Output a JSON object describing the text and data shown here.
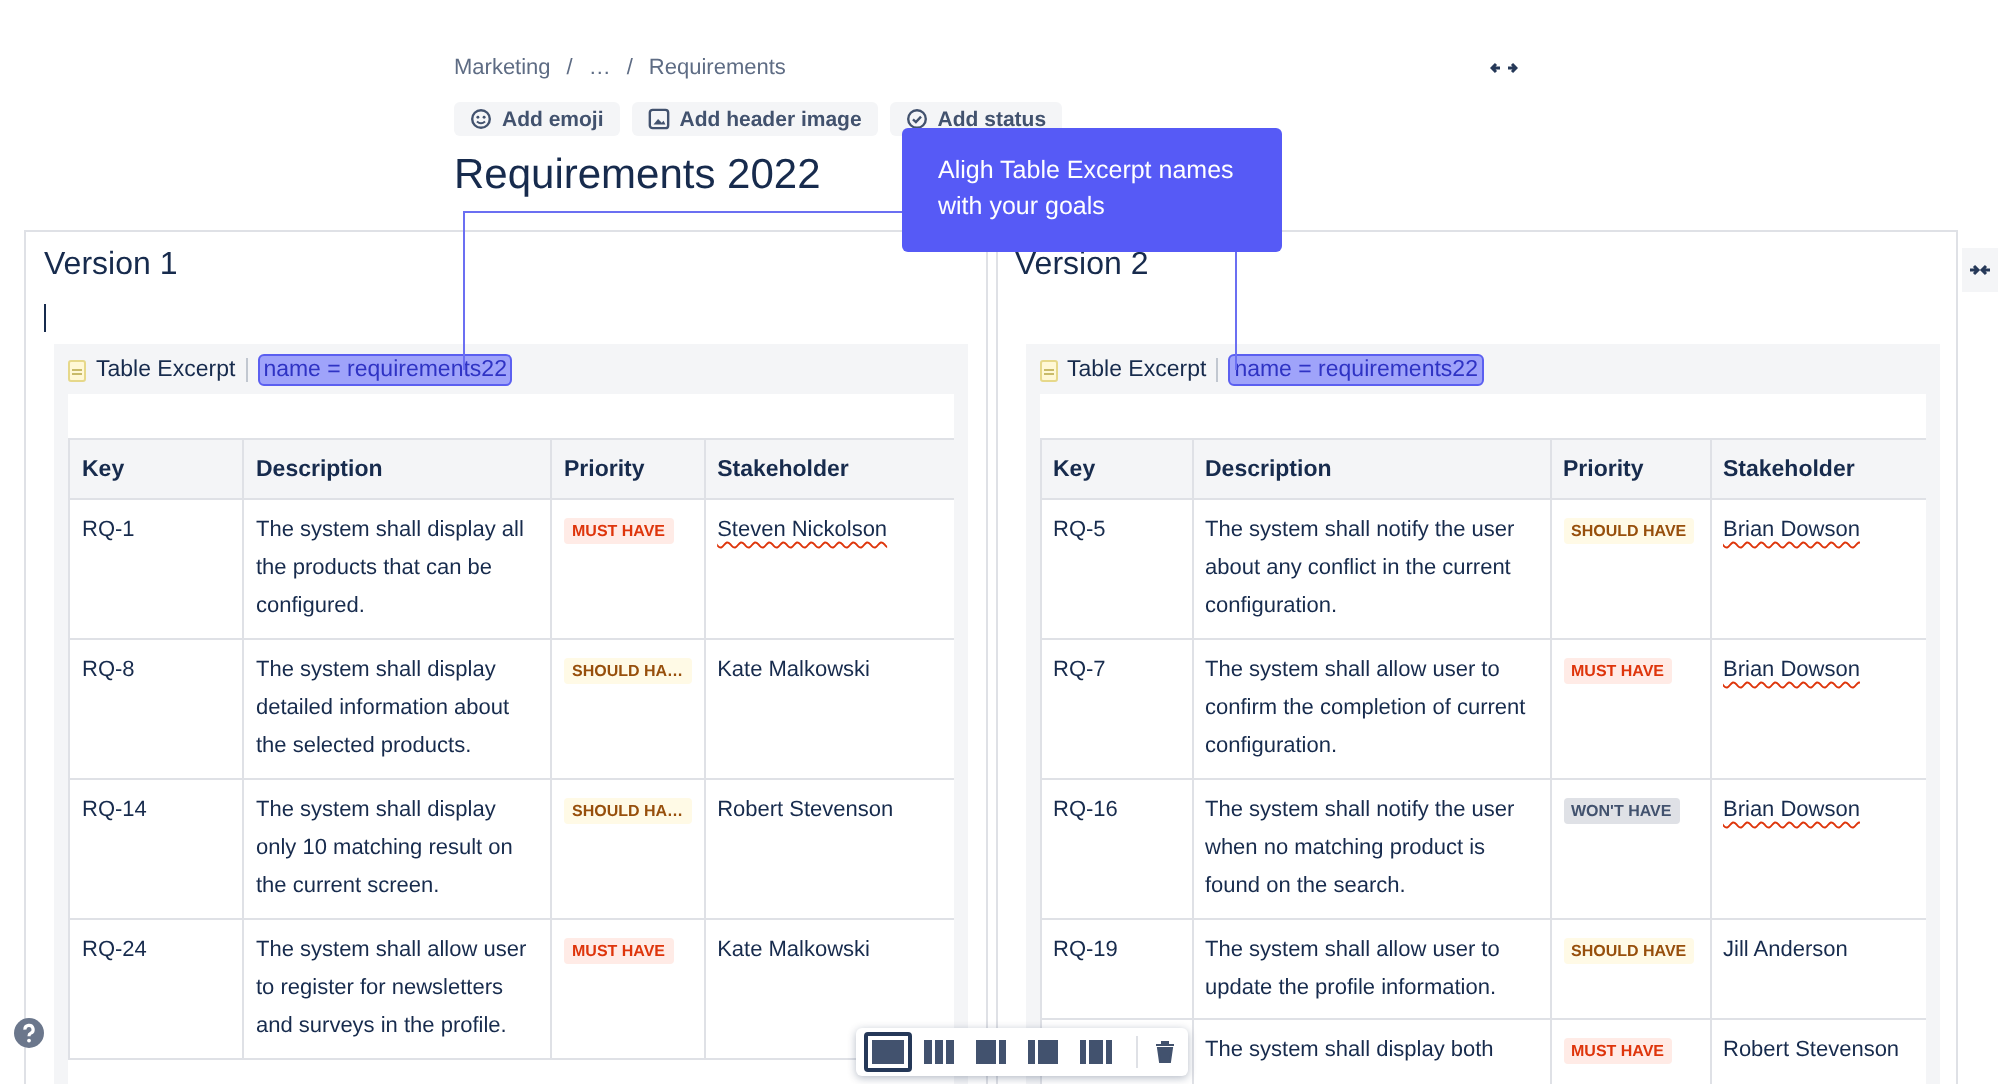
{
  "breadcrumb": {
    "items": [
      "Marketing",
      "…",
      "Requirements"
    ],
    "separator": "/"
  },
  "header_buttons": [
    {
      "label": "Add emoji",
      "kind": "emoji"
    },
    {
      "label": "Add header image",
      "kind": "image"
    },
    {
      "label": "Add status",
      "kind": "status"
    }
  ],
  "page_title": "Requirements 2022",
  "tooltip": "Aligh Table Excerpt names with your goals",
  "panels": [
    {
      "title": "Version 1",
      "text_cursor": true,
      "excerpt_label": "Table Excerpt",
      "excerpt_name": "name = requirements22",
      "columns": [
        "Key",
        "Description",
        "Priority",
        "Stakeholder"
      ],
      "rows": [
        {
          "key": "RQ-1",
          "description": "The system shall display all the products that can be configured.",
          "priority": {
            "label": "MUST HAVE",
            "kind": "must"
          },
          "stakeholder": "Steven Nickolson",
          "misspelled": true
        },
        {
          "key": "RQ-8",
          "description": "The system shall display detailed information about the selected products.",
          "priority": {
            "label": "SHOULD HA…",
            "kind": "should"
          },
          "stakeholder": "Kate Malkowski",
          "misspelled": false
        },
        {
          "key": "RQ-14",
          "description": "The system shall display only 10 matching result on the current screen.",
          "priority": {
            "label": "SHOULD HA…",
            "kind": "should"
          },
          "stakeholder": "Robert Stevenson",
          "misspelled": false
        },
        {
          "key": "RQ-24",
          "description": "The system shall allow user to register for newsletters and surveys in the profile.",
          "priority": {
            "label": "MUST HAVE",
            "kind": "must"
          },
          "stakeholder": "Kate Malkowski",
          "misspelled": false
        }
      ]
    },
    {
      "title": "Version 2",
      "text_cursor": false,
      "excerpt_label": "Table Excerpt",
      "excerpt_name": "name = requirements22",
      "columns": [
        "Key",
        "Description",
        "Priority",
        "Stakeholder"
      ],
      "rows": [
        {
          "key": "RQ-5",
          "description": "The system shall notify the user about any conflict in the current configuration.",
          "priority": {
            "label": "SHOULD HAVE",
            "kind": "should"
          },
          "stakeholder": "Brian Dowson",
          "misspelled": true
        },
        {
          "key": "RQ-7",
          "description": "The system shall allow user to confirm the completion of current configuration.",
          "priority": {
            "label": "MUST HAVE",
            "kind": "must"
          },
          "stakeholder": "Brian Dowson",
          "misspelled": true
        },
        {
          "key": "RQ-16",
          "description": "The system shall notify the user when no matching product is found on the search.",
          "priority": {
            "label": "WON'T HAVE",
            "kind": "wont"
          },
          "stakeholder": "Brian Dowson",
          "misspelled": true
        },
        {
          "key": "RQ-19",
          "description": "The system shall allow user to update the profile information.",
          "priority": {
            "label": "SHOULD HAVE",
            "kind": "should"
          },
          "stakeholder": "Jill Anderson",
          "misspelled": false
        },
        {
          "description": "The system shall display both",
          "priority": {
            "label": "MUST HAVE",
            "kind": "must"
          },
          "stakeholder": "Robert Stevenson",
          "misspelled": false
        }
      ]
    }
  ],
  "layout_toolbar": {
    "layouts": [
      {
        "kind": "two",
        "selected": true
      },
      {
        "kind": "three",
        "selected": false
      },
      {
        "kind": "right",
        "selected": false
      },
      {
        "kind": "left",
        "selected": false
      },
      {
        "kind": "sides",
        "selected": false
      }
    ]
  }
}
